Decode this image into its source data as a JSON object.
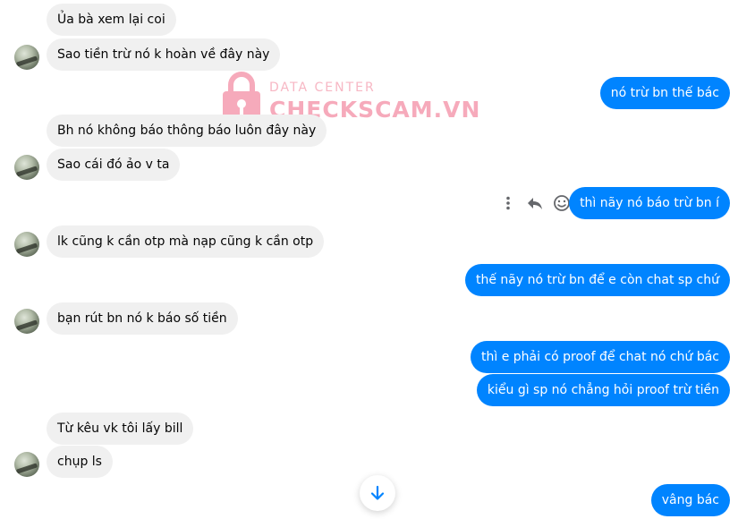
{
  "watermark": {
    "line1": "DATA CENTER",
    "line2": "CHECKSCAM.VN",
    "color": "#f6aabb"
  },
  "colors": {
    "incoming_bubble": "#f0f0f0",
    "outgoing_bubble": "#0084ff",
    "incoming_text": "#050505",
    "outgoing_text": "#ffffff"
  },
  "messages": [
    {
      "side": "in",
      "text": "Ủa bà xem lại coi"
    },
    {
      "side": "in",
      "text": "Sao tiền trừ nó k hoàn về đây này"
    },
    {
      "side": "out",
      "text": "nó trừ bn thế bác"
    },
    {
      "side": "in",
      "text": "Bh nó không báo thông báo luôn đây này"
    },
    {
      "side": "in",
      "text": "Sao cái đó ảo v ta"
    },
    {
      "side": "out",
      "text": "thì nãy nó báo trừ bn í"
    },
    {
      "side": "in",
      "text": "lk cũng k cần otp mà nạp cũng k cần otp"
    },
    {
      "side": "out",
      "text": "thế nãy nó trừ bn để e còn chat sp chứ"
    },
    {
      "side": "in",
      "text": "bạn rút bn nó k báo số tiền"
    },
    {
      "side": "out",
      "text": "thì e phải có proof để chat nó chứ bác"
    },
    {
      "side": "out",
      "text": "kiểu gì sp nó chẳng hỏi proof trừ tiền"
    },
    {
      "side": "in",
      "text": "Từ kêu vk tôi lấy bill"
    },
    {
      "side": "in",
      "text": "chụp ls"
    },
    {
      "side": "out",
      "text": "vâng bác"
    }
  ],
  "message_actions": [
    "more-options-icon",
    "reply-icon",
    "react-icon"
  ],
  "scroll_button_icon": "arrow-down-icon"
}
